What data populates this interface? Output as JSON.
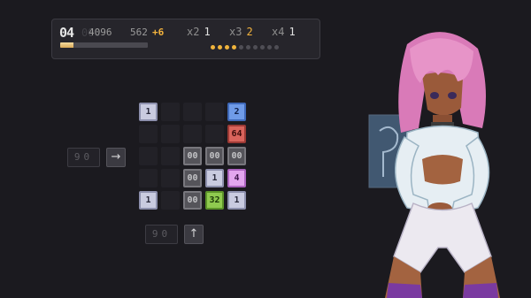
{
  "hud": {
    "level": "04",
    "score_ghost": "000",
    "score": "4096",
    "lines": "562",
    "bonus": "+6",
    "progress": 0.15,
    "multipliers": [
      {
        "label": "x2",
        "value": "1",
        "hot": false
      },
      {
        "label": "x3",
        "value": "2",
        "hot": true
      },
      {
        "label": "x4",
        "value": "1",
        "hot": false
      }
    ],
    "combo_dots_total": 10,
    "combo_dots_lit": 4,
    "colors": {
      "accent": "#f3b33d",
      "progress_fill": "#d9a957"
    }
  },
  "board": {
    "rows": [
      [
        "1",
        "",
        "",
        "",
        "2"
      ],
      [
        "",
        "",
        "",
        "",
        "64"
      ],
      [
        "",
        "",
        "00",
        "00",
        "00"
      ],
      [
        "",
        "",
        "00",
        "1",
        "4"
      ],
      [
        "1",
        "",
        "00",
        "32",
        "1"
      ]
    ],
    "tile_colors": {
      "1": "#c9cbe0",
      "2": "#6f9be8",
      "4": "#e3a6ee",
      "32": "#8fca4f",
      "64": "#d9645c",
      "00": "#55545a"
    }
  },
  "controls": {
    "row_counter": "90",
    "row_arrow": "→",
    "col_counter": "90",
    "col_arrow": "↑"
  }
}
